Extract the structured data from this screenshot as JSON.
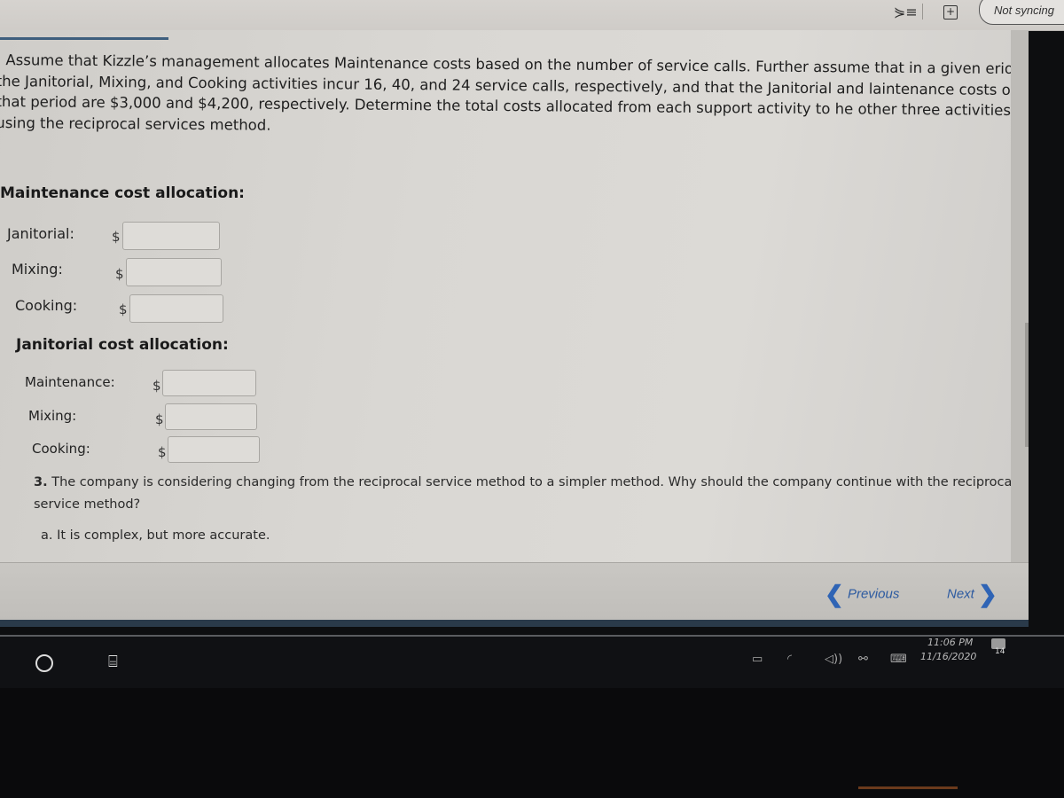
{
  "browser": {
    "sync_status": "Not syncing",
    "icons": [
      "reading-list-icon",
      "collections-icon"
    ]
  },
  "question": {
    "intro": ". Assume that Kizzle’s management allocates Maintenance costs based on the number of service calls. Further assume that in a given eriod, the Janitorial, Mixing, and Cooking activities incur 16, 40, and 24 service calls, respectively, and that the Janitorial and laintenance costs of that period are $3,000 and $4,200, respectively. Determine the total costs allocated from each support activity to he other three activities using the reciprocal services method.",
    "currency_symbol": "$",
    "maintenance_section": {
      "title": "Maintenance cost allocation:",
      "rows": [
        {
          "label": "Janitorial:",
          "value": ""
        },
        {
          "label": "Mixing:",
          "value": ""
        },
        {
          "label": "Cooking:",
          "value": ""
        }
      ]
    },
    "janitorial_section": {
      "title": "Janitorial cost allocation:",
      "rows": [
        {
          "label": "Maintenance:",
          "value": ""
        },
        {
          "label": "Mixing:",
          "value": ""
        },
        {
          "label": "Cooking:",
          "value": ""
        }
      ]
    },
    "q3": {
      "number": "3.",
      "text": "The company is considering changing from the reciprocal service method to a simpler method. Why should the company continue with the reciprocal service method?",
      "answer_a": "a. It is complex, but more accurate."
    }
  },
  "navigation": {
    "previous_label": "Previous",
    "next_label": "Next",
    "prev_glyph": "❮",
    "next_glyph": "❯"
  },
  "taskbar": {
    "time": "11:06 PM",
    "date": "11/16/2020",
    "notification_count": "14"
  }
}
